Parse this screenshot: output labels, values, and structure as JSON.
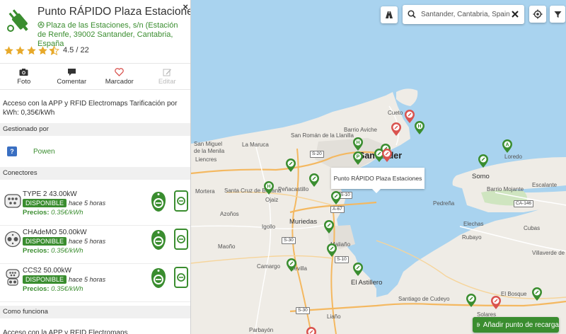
{
  "station": {
    "name": "Punto RÁPIDO Plaza Estaciones",
    "address": "Plaza de las Estaciones, s/n (Estación de Renfe, 39002 Santander, Cantabria, España",
    "rating_value": 4.5,
    "rating_text": "4.5 / 22",
    "close_label": "×"
  },
  "actions": [
    {
      "label": "Foto",
      "icon": "camera-icon"
    },
    {
      "label": "Comentar",
      "icon": "comment-icon"
    },
    {
      "label": "Marcador",
      "icon": "heart-icon"
    },
    {
      "label": "Editar",
      "icon": "edit-icon"
    }
  ],
  "description": "Acceso con la APP y RFID Electromaps Tarificación por kWh: 0,35€/kWh",
  "sections": {
    "managed_by": "Gestionado por",
    "connectors": "Conectores",
    "how_it_works": "Como funciona"
  },
  "operator": {
    "logo": "?",
    "name": "Powen"
  },
  "connectors": [
    {
      "name": "TYPE 2 43.00kW",
      "status": "DISPONIBLE",
      "since": "hace 5 horas",
      "price_label": "Precios:",
      "price": "0.35€/kWh",
      "plug": "type2"
    },
    {
      "name": "CHAdeMO 50.00kW",
      "status": "DISPONIBLE",
      "since": "hace 5 horas",
      "price_label": "Precios:",
      "price": "0.35€/kWh",
      "plug": "chademo"
    },
    {
      "name": "CCS2 50.00kW",
      "status": "DISPONIBLE",
      "since": "hace 5 horas",
      "price_label": "Precios:",
      "price": "0.35€/kWh",
      "plug": "ccs2"
    }
  ],
  "how_it_works_text": "Acceso con la APP y RFID Electromaps",
  "map": {
    "search_value": "Santander, Cantabria, Spain",
    "tooltip": "Punto RÁPIDO Plaza Estaciones",
    "add_button": "Añadir punto de recarga",
    "labels": {
      "cueto": "Cueto",
      "barrio_aviche": "Barrio Aviche",
      "san_roman": "San Román de la Llanilla",
      "santander": "Santander",
      "loredo": "Loredo",
      "somo": "Somo",
      "la_maruca": "La Maruca",
      "san_miguel": "San Miguel",
      "de_la_menila": "de la Menila",
      "liencres": "Liencres",
      "mortera": "Mortera",
      "santa_cruz": "Santa Cruz de Bezana",
      "penacastillo": "Peñacastillo",
      "ojaiz": "Ojaiz",
      "azoños": "Azoños",
      "igollo": "Igollo",
      "muriedas": "Muriedas",
      "maliano": "Maliaño",
      "maoño": "Maoño",
      "camargo": "Camargo",
      "revilla": "Revilla",
      "el_astillero": "El Astillero",
      "santiago": "Santiago de Cudeyo",
      "el_bosque": "El Bosque",
      "solares": "Solares",
      "parbayon": "Parbayón",
      "liaño": "Liaño",
      "pedreña": "Pedreña",
      "rubayo": "Rubayo",
      "villaverde": "Villaverde de Pontones",
      "escalante": "Escalante",
      "barrio_mojante": "Barrio Mojante",
      "elechas": "Elechas",
      "cubas": "Cubas",
      "s20": "S-20",
      "s30": "S-30",
      "s10": "S-10",
      "a67": "A-67",
      "ca146": "CA-146",
      "n611": "N-611",
      "ca141": "CA-141",
      "s30b": "S-30"
    }
  },
  "colors": {
    "accent": "#3a8d2f",
    "water": "#a9d3ef",
    "land": "#efece6",
    "pin_red": "#d9534f"
  }
}
